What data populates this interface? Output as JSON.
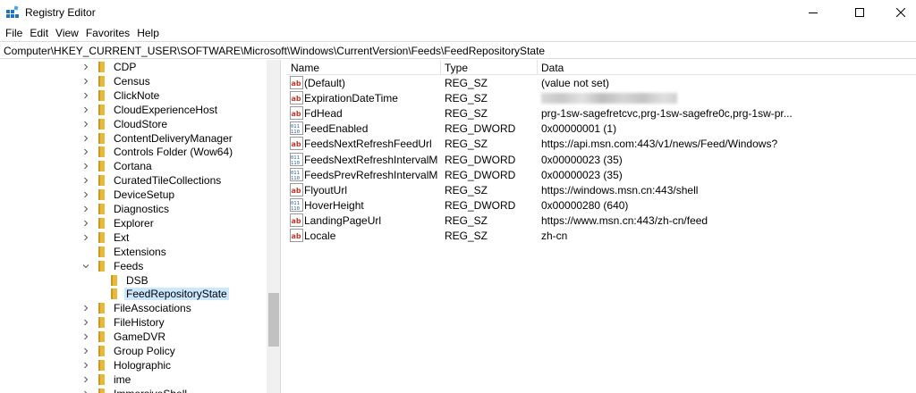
{
  "window": {
    "title": "Registry Editor"
  },
  "menu": [
    "File",
    "Edit",
    "View",
    "Favorites",
    "Help"
  ],
  "address": "Computer\\HKEY_CURRENT_USER\\SOFTWARE\\Microsoft\\Windows\\CurrentVersion\\Feeds\\FeedRepositoryState",
  "tree": [
    {
      "label": "CDP",
      "expander": "collapsed",
      "level": 0
    },
    {
      "label": "Census",
      "expander": "collapsed",
      "level": 0
    },
    {
      "label": "ClickNote",
      "expander": "collapsed",
      "level": 0
    },
    {
      "label": "CloudExperienceHost",
      "expander": "collapsed",
      "level": 0
    },
    {
      "label": "CloudStore",
      "expander": "collapsed",
      "level": 0
    },
    {
      "label": "ContentDeliveryManager",
      "expander": "collapsed",
      "level": 0
    },
    {
      "label": "Controls Folder (Wow64)",
      "expander": "collapsed",
      "level": 0
    },
    {
      "label": "Cortana",
      "expander": "collapsed",
      "level": 0
    },
    {
      "label": "CuratedTileCollections",
      "expander": "collapsed",
      "level": 0
    },
    {
      "label": "DeviceSetup",
      "expander": "collapsed",
      "level": 0
    },
    {
      "label": "Diagnostics",
      "expander": "collapsed",
      "level": 0
    },
    {
      "label": "Explorer",
      "expander": "collapsed",
      "level": 0
    },
    {
      "label": "Ext",
      "expander": "collapsed",
      "level": 0
    },
    {
      "label": "Extensions",
      "expander": "none",
      "level": 0
    },
    {
      "label": "Feeds",
      "expander": "expanded",
      "level": 0
    },
    {
      "label": "DSB",
      "expander": "none",
      "level": 1
    },
    {
      "label": "FeedRepositoryState",
      "expander": "none",
      "level": 1,
      "selected": true
    },
    {
      "label": "FileAssociations",
      "expander": "collapsed",
      "level": 0
    },
    {
      "label": "FileHistory",
      "expander": "collapsed",
      "level": 0
    },
    {
      "label": "GameDVR",
      "expander": "collapsed",
      "level": 0
    },
    {
      "label": "Group Policy",
      "expander": "collapsed",
      "level": 0
    },
    {
      "label": "Holographic",
      "expander": "collapsed",
      "level": 0
    },
    {
      "label": "ime",
      "expander": "collapsed",
      "level": 0
    },
    {
      "label": "ImmersiveShell",
      "expander": "collapsed",
      "level": 0
    }
  ],
  "list": {
    "columns": [
      "Name",
      "Type",
      "Data"
    ],
    "rows": [
      {
        "icon": "string-value-icon",
        "name": "(Default)",
        "type": "REG_SZ",
        "data": "(value not set)"
      },
      {
        "icon": "string-value-icon",
        "name": "ExpirationDateTime",
        "type": "REG_SZ",
        "data": "",
        "redacted": true
      },
      {
        "icon": "string-value-icon",
        "name": "FdHead",
        "type": "REG_SZ",
        "data": "prg-1sw-sagefretcvc,prg-1sw-sagefre0c,prg-1sw-pr..."
      },
      {
        "icon": "binary-value-icon",
        "name": "FeedEnabled",
        "type": "REG_DWORD",
        "data": "0x00000001 (1)"
      },
      {
        "icon": "string-value-icon",
        "name": "FeedsNextRefreshFeedUrl",
        "type": "REG_SZ",
        "data": "https://api.msn.com:443/v1/news/Feed/Windows?"
      },
      {
        "icon": "binary-value-icon",
        "name": "FeedsNextRefreshIntervalMinu...",
        "type": "REG_DWORD",
        "data": "0x00000023 (35)"
      },
      {
        "icon": "binary-value-icon",
        "name": "FeedsPrevRefreshIntervalMinut...",
        "type": "REG_DWORD",
        "data": "0x00000023 (35)"
      },
      {
        "icon": "string-value-icon",
        "name": "FlyoutUrl",
        "type": "REG_SZ",
        "data": "https://windows.msn.cn:443/shell"
      },
      {
        "icon": "binary-value-icon",
        "name": "HoverHeight",
        "type": "REG_DWORD",
        "data": "0x00000280 (640)"
      },
      {
        "icon": "string-value-icon",
        "name": "LandingPageUrl",
        "type": "REG_SZ",
        "data": "https://www.msn.cn:443/zh-cn/feed"
      },
      {
        "icon": "string-value-icon",
        "name": "Locale",
        "type": "REG_SZ",
        "data": "zh-cn"
      }
    ]
  },
  "colors": {
    "selection": "#cce8ff",
    "folder": "#e8b93a",
    "string_icon": "#c0392b",
    "binary_icon": "#2a5fa8"
  }
}
